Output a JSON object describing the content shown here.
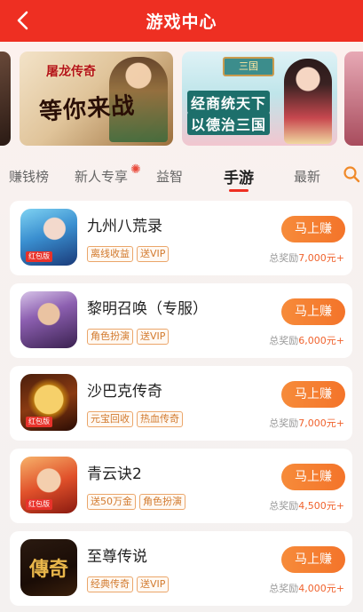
{
  "header": {
    "title": "游戏中心",
    "back_icon": "chevron-left-icon"
  },
  "banners": [
    {
      "logo": "屠龙传奇",
      "slogan": "等你来战"
    },
    {
      "sign": "三国",
      "line1": "经商统天下",
      "line2": "以德治三国"
    }
  ],
  "tabs": [
    {
      "label": "赚钱榜"
    },
    {
      "label": "新人专享",
      "burst": "✺"
    },
    {
      "label": "益智"
    },
    {
      "label": "手游"
    },
    {
      "label": "最新"
    }
  ],
  "active_tab": "手游",
  "colors": {
    "brand_red": "#ee2f22",
    "button_orange": "#f4742a",
    "tag_orange": "#d27a2e"
  },
  "games": [
    {
      "name": "九州八荒录",
      "tags": [
        "离线收益",
        "送VIP"
      ],
      "badge": "红包版",
      "button": "马上赚",
      "reward_label": "总奖励",
      "reward_amount": "7,000元+"
    },
    {
      "name": "黎明召唤（专服）",
      "tags": [
        "角色扮演",
        "送VIP"
      ],
      "badge": "",
      "button": "马上赚",
      "reward_label": "总奖励",
      "reward_amount": "6,000元+"
    },
    {
      "name": "沙巴克传奇",
      "tags": [
        "元宝回收",
        "热血传奇"
      ],
      "badge": "红包版",
      "button": "马上赚",
      "reward_label": "总奖励",
      "reward_amount": "7,000元+"
    },
    {
      "name": "青云诀2",
      "tags": [
        "送50万金",
        "角色扮演"
      ],
      "badge": "红包版",
      "button": "马上赚",
      "reward_label": "总奖励",
      "reward_amount": "4,500元+"
    },
    {
      "name": "至尊传说",
      "tags": [
        "经典传奇",
        "送VIP"
      ],
      "badge": "",
      "icon_text": "傳奇",
      "button": "马上赚",
      "reward_label": "总奖励",
      "reward_amount": "4,000元+"
    }
  ]
}
